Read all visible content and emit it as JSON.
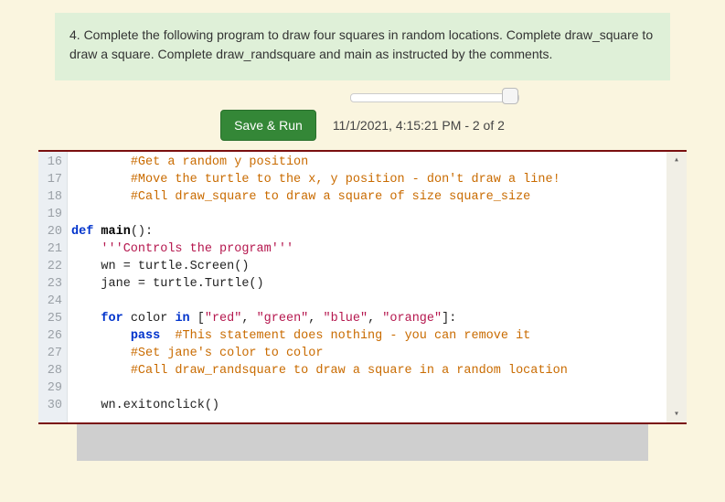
{
  "instruction": "4. Complete the following program to draw four squares in random locations. Complete draw_square to draw a square. Complete draw_randsquare and main as instructed by the comments.",
  "toolbar": {
    "save_run_label": "Save & Run",
    "status": "11/1/2021, 4:15:21 PM - 2 of 2"
  },
  "code": {
    "first_line_number": 16,
    "lines": [
      {
        "n": 16,
        "indent": 2,
        "tokens": [
          {
            "cls": "c-comment",
            "t": "#Get a random y position"
          }
        ]
      },
      {
        "n": 17,
        "indent": 2,
        "tokens": [
          {
            "cls": "c-comment",
            "t": "#Move the turtle to the x, y position - don't draw a line!"
          }
        ]
      },
      {
        "n": 18,
        "indent": 2,
        "tokens": [
          {
            "cls": "c-comment",
            "t": "#Call draw_square to draw a square of size square_size"
          }
        ]
      },
      {
        "n": 19,
        "indent": 0,
        "tokens": []
      },
      {
        "n": 20,
        "indent": 0,
        "tokens": [
          {
            "cls": "c-kw",
            "t": "def"
          },
          {
            "cls": "",
            "t": " "
          },
          {
            "cls": "c-def",
            "t": "main"
          },
          {
            "cls": "",
            "t": "():"
          }
        ]
      },
      {
        "n": 21,
        "indent": 1,
        "tokens": [
          {
            "cls": "c-str",
            "t": "'''Controls the program'''"
          }
        ]
      },
      {
        "n": 22,
        "indent": 1,
        "tokens": [
          {
            "cls": "",
            "t": "wn = turtle.Screen()"
          }
        ]
      },
      {
        "n": 23,
        "indent": 1,
        "tokens": [
          {
            "cls": "",
            "t": "jane = turtle.Turtle()"
          }
        ]
      },
      {
        "n": 24,
        "indent": 0,
        "tokens": []
      },
      {
        "n": 25,
        "indent": 1,
        "tokens": [
          {
            "cls": "c-kw",
            "t": "for"
          },
          {
            "cls": "",
            "t": " color "
          },
          {
            "cls": "c-kw",
            "t": "in"
          },
          {
            "cls": "",
            "t": " ["
          },
          {
            "cls": "c-str",
            "t": "\"red\""
          },
          {
            "cls": "",
            "t": ", "
          },
          {
            "cls": "c-str",
            "t": "\"green\""
          },
          {
            "cls": "",
            "t": ", "
          },
          {
            "cls": "c-str",
            "t": "\"blue\""
          },
          {
            "cls": "",
            "t": ", "
          },
          {
            "cls": "c-str",
            "t": "\"orange\""
          },
          {
            "cls": "",
            "t": "]:"
          }
        ]
      },
      {
        "n": 26,
        "indent": 2,
        "tokens": [
          {
            "cls": "c-kw",
            "t": "pass"
          },
          {
            "cls": "",
            "t": "  "
          },
          {
            "cls": "c-comment",
            "t": "#This statement does nothing - you can remove it"
          }
        ]
      },
      {
        "n": 27,
        "indent": 2,
        "tokens": [
          {
            "cls": "c-comment",
            "t": "#Set jane's color to color"
          }
        ]
      },
      {
        "n": 28,
        "indent": 2,
        "tokens": [
          {
            "cls": "c-comment",
            "t": "#Call draw_randsquare to draw a square in a random location"
          }
        ]
      },
      {
        "n": 29,
        "indent": 0,
        "tokens": []
      },
      {
        "n": 30,
        "indent": 1,
        "tokens": [
          {
            "cls": "",
            "t": "wn.exitonclick()"
          }
        ]
      }
    ]
  }
}
